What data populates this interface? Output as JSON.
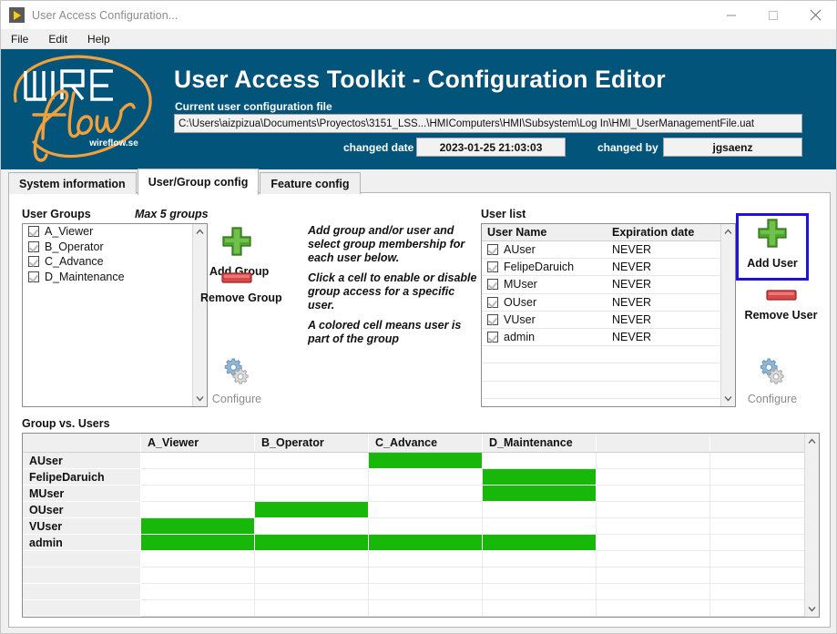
{
  "window": {
    "title": "User Access Configuration...",
    "app_icon": "labview-run-arrow-icon",
    "minimize_label": "Minimize",
    "maximize_label": "Maximize",
    "close_label": "Close"
  },
  "menubar": {
    "items": [
      {
        "label": "File"
      },
      {
        "label": "Edit"
      },
      {
        "label": "Help"
      }
    ]
  },
  "banner": {
    "background_color": "#02547A",
    "logo": {
      "word_mark": "WIRE",
      "script_mark": "flow",
      "url_text": "wireflow.se",
      "accent_color": "#F0A13C"
    },
    "title": "User Access Toolkit - Configuration Editor",
    "config_file_label": "Current user configuration file",
    "config_file_path": "C:\\Users\\aizpizua\\Documents\\Proyectos\\3151_LSS...\\HMIComputers\\HMI\\Subsystem\\Log In\\HMI_UserManagementFile.uat",
    "changed_date_label": "changed date",
    "changed_date_value": "2023-01-25 21:03:03",
    "changed_by_label": "changed by",
    "changed_by_value": "jgsaenz"
  },
  "tabs": [
    {
      "label": "System information",
      "active": false
    },
    {
      "label": "User/Group config",
      "active": true
    },
    {
      "label": "Feature config",
      "active": false
    }
  ],
  "user_groups": {
    "label": "User Groups",
    "note": "Max 5 groups",
    "rows": [
      {
        "name": "A_Viewer",
        "checked": true
      },
      {
        "name": "B_Operator",
        "checked": true
      },
      {
        "name": "C_Advance",
        "checked": true
      },
      {
        "name": "D_Maintenance",
        "checked": true
      }
    ],
    "empty_rows": 12
  },
  "group_commands": [
    {
      "name": "add-group",
      "label": "Add Group",
      "icon": "green-plus-icon",
      "disabled": false
    },
    {
      "name": "remove-group",
      "label": "Remove Group",
      "icon": "red-minus-icon",
      "disabled": false
    },
    {
      "name": "configure-group",
      "label": "Configure",
      "icon": "gears-icon",
      "disabled": true
    }
  ],
  "instructions": [
    "Add group and/or user and select group membership for each user below.",
    "Click a cell to enable or disable group access for a specific user.",
    "A colored cell means user is part of the group"
  ],
  "user_list": {
    "label": "User list",
    "columns": [
      "User Name",
      "Expiration date"
    ],
    "rows": [
      {
        "name": "AUser",
        "checked": true,
        "expiration": "NEVER"
      },
      {
        "name": "FelipeDaruich",
        "checked": true,
        "expiration": "NEVER"
      },
      {
        "name": "MUser",
        "checked": true,
        "expiration": "NEVER"
      },
      {
        "name": "OUser",
        "checked": true,
        "expiration": "NEVER"
      },
      {
        "name": "VUser",
        "checked": true,
        "expiration": "NEVER"
      },
      {
        "name": "admin",
        "checked": true,
        "expiration": "NEVER"
      }
    ],
    "empty_rows": 4
  },
  "user_commands": [
    {
      "name": "add-user",
      "label": "Add User",
      "icon": "green-plus-icon",
      "disabled": false,
      "focused": true
    },
    {
      "name": "remove-user",
      "label": "Remove User",
      "icon": "red-minus-icon",
      "disabled": false,
      "focused": false
    },
    {
      "name": "configure-user",
      "label": "Configure",
      "icon": "gears-icon",
      "disabled": true,
      "focused": false
    }
  ],
  "matrix": {
    "label": "Group vs. Users",
    "corner_label": "",
    "columns": [
      "A_Viewer",
      "B_Operator",
      "C_Advance",
      "D_Maintenance",
      "",
      ""
    ],
    "rows": [
      "AUser",
      "FelipeDaruich",
      "MUser",
      "OUser",
      "VUser",
      "admin",
      "",
      "",
      "",
      ""
    ],
    "on_color": "#17B80A",
    "cells": [
      [
        false,
        false,
        true,
        false,
        false,
        false
      ],
      [
        false,
        false,
        false,
        true,
        false,
        false
      ],
      [
        false,
        false,
        false,
        true,
        false,
        false
      ],
      [
        false,
        true,
        false,
        false,
        false,
        false
      ],
      [
        true,
        false,
        false,
        false,
        false,
        false
      ],
      [
        true,
        true,
        true,
        true,
        false,
        false
      ],
      [
        false,
        false,
        false,
        false,
        false,
        false
      ],
      [
        false,
        false,
        false,
        false,
        false,
        false
      ],
      [
        false,
        false,
        false,
        false,
        false,
        false
      ],
      [
        false,
        false,
        false,
        false,
        false,
        false
      ]
    ]
  }
}
